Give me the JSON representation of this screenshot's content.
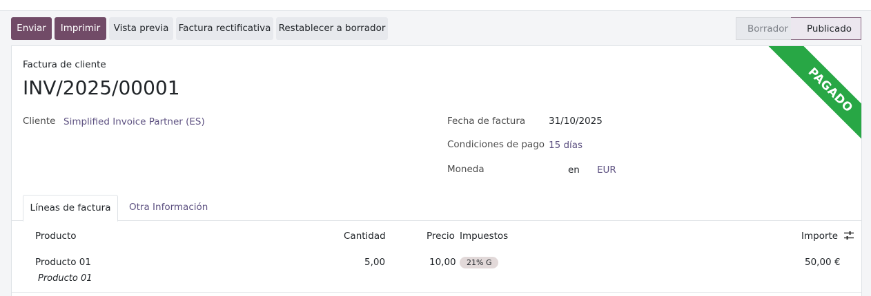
{
  "toolbar": {
    "send": "Enviar",
    "print": "Imprimir",
    "preview": "Vista previa",
    "credit_note": "Factura rectificativa",
    "reset_draft": "Restablecer a borrador"
  },
  "status": {
    "draft": "Borrador",
    "posted": "Publicado",
    "current": "posted"
  },
  "invoice": {
    "type_label": "Factura de cliente",
    "name": "INV/2025/00001",
    "ribbon": "PAGADO",
    "ribbon_color": "#28a745",
    "customer_label": "Cliente",
    "customer": "Simplified Invoice Partner (ES)",
    "date_label": "Fecha de factura",
    "date": "31/10/2025",
    "terms_label": "Condiciones de pago",
    "terms": "15 días",
    "currency_label": "Moneda",
    "currency_lang": "en",
    "currency": "EUR"
  },
  "tabs": [
    {
      "label": "Líneas de factura",
      "active": true
    },
    {
      "label": "Otra Información",
      "active": false
    }
  ],
  "lines": {
    "headers": {
      "product": "Producto",
      "quantity": "Cantidad",
      "price": "Precio",
      "taxes": "Impuestos",
      "amount": "Importe"
    },
    "rows": [
      {
        "product": "Producto 01",
        "description": "Producto 01",
        "quantity": "5,00",
        "price": "10,00",
        "tax": "21% G",
        "amount": "50,00 €"
      }
    ]
  },
  "colors": {
    "primary": "#714b67",
    "link": "#5d5181",
    "paid": "#28a745"
  }
}
